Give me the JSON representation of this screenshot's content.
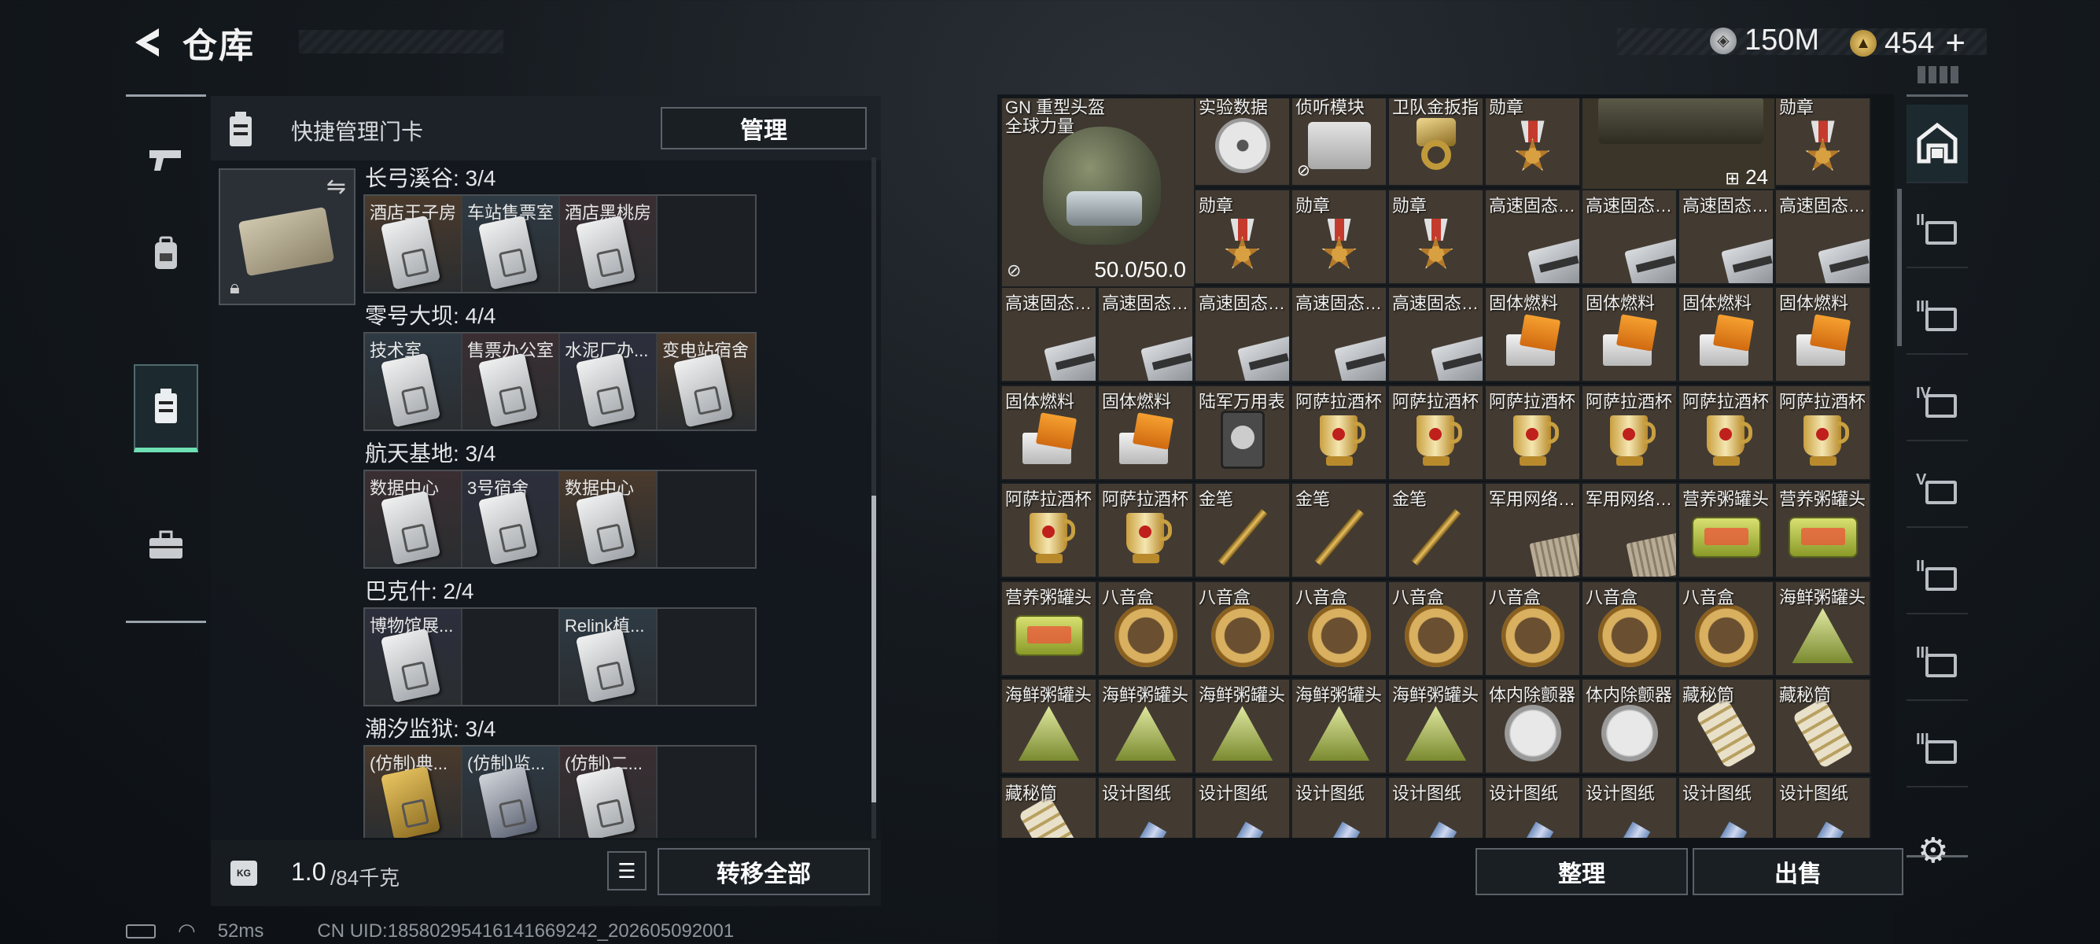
{
  "header": {
    "title": "仓库",
    "currency_a": "150M",
    "currency_b": "454"
  },
  "left_panel": {
    "head_label": "快捷管理门卡",
    "manage_label": "管理",
    "sections": [
      {
        "title": "长弓溪谷: 3/4",
        "cards": [
          {
            "label": "酒店王子房",
            "style": "normal"
          },
          {
            "label": "车站售票室",
            "style": "normal"
          },
          {
            "label": "酒店黑桃房",
            "style": "normal"
          },
          {
            "label": "",
            "style": "empty"
          }
        ]
      },
      {
        "title": "零号大坝: 4/4",
        "cards": [
          {
            "label": "技术室",
            "style": "normal"
          },
          {
            "label": "售票办公室",
            "style": "normal"
          },
          {
            "label": "水泥厂办...",
            "style": "normal"
          },
          {
            "label": "变电站宿舍",
            "style": "normal"
          }
        ]
      },
      {
        "title": "航天基地: 3/4",
        "cards": [
          {
            "label": "数据中心",
            "style": "normal"
          },
          {
            "label": "3号宿舍",
            "style": "normal"
          },
          {
            "label": "数据中心",
            "style": "normal"
          },
          {
            "label": "",
            "style": "empty"
          }
        ]
      },
      {
        "title": "巴克什: 2/4",
        "cards": [
          {
            "label": "博物馆展...",
            "style": "normal"
          },
          {
            "label": "",
            "style": "empty"
          },
          {
            "label": "Relink植...",
            "style": "normal"
          },
          {
            "label": "",
            "style": "empty"
          }
        ]
      },
      {
        "title": "潮汐监狱: 3/4",
        "cards": [
          {
            "label": "(仿制)典...",
            "style": "gold"
          },
          {
            "label": "(仿制)监...",
            "style": "dark"
          },
          {
            "label": "(仿制)二...",
            "style": "normal"
          },
          {
            "label": "",
            "style": "empty"
          }
        ]
      }
    ],
    "weight_value": "1.0",
    "weight_total": "/84千克",
    "weight_icon_text": "KG",
    "transfer_all_label": "转移全部"
  },
  "grid": {
    "helmet": {
      "name": "GN 重型头盔",
      "sub": "全球力量",
      "durability": "50.0/50.0"
    },
    "items": [
      {
        "col": 2,
        "row": 0,
        "name": "实验数据",
        "icon": "disc"
      },
      {
        "col": 3,
        "row": 0,
        "name": "侦听模块",
        "icon": "disk",
        "noicon": true
      },
      {
        "col": 4,
        "row": 0,
        "name": "卫队金扳指",
        "icon": "ring"
      },
      {
        "col": 5,
        "row": 0,
        "name": "勋章",
        "icon": "medal"
      },
      {
        "col": 8,
        "row": 0,
        "name": "勋章",
        "icon": "medal"
      },
      {
        "col": 2,
        "row": 1,
        "name": "勋章",
        "icon": "medal"
      },
      {
        "col": 3,
        "row": 1,
        "name": "勋章",
        "icon": "medal"
      },
      {
        "col": 4,
        "row": 1,
        "name": "勋章",
        "icon": "medal"
      },
      {
        "col": 5,
        "row": 1,
        "name": "高速固态硬盘",
        "icon": "drive"
      },
      {
        "col": 6,
        "row": 1,
        "name": "高速固态硬盘",
        "icon": "drive"
      },
      {
        "col": 7,
        "row": 1,
        "name": "高速固态硬盘",
        "icon": "drive"
      },
      {
        "col": 8,
        "row": 1,
        "name": "高速固态硬盘",
        "icon": "drive"
      },
      {
        "col": 0,
        "row": 2,
        "name": "高速固态硬盘",
        "icon": "drive"
      },
      {
        "col": 1,
        "row": 2,
        "name": "高速固态硬盘",
        "icon": "drive"
      },
      {
        "col": 2,
        "row": 2,
        "name": "高速固态硬盘",
        "icon": "drive"
      },
      {
        "col": 3,
        "row": 2,
        "name": "高速固态硬盘",
        "icon": "drive"
      },
      {
        "col": 4,
        "row": 2,
        "name": "高速固态硬盘",
        "icon": "drive"
      },
      {
        "col": 5,
        "row": 2,
        "name": "固体燃料",
        "icon": "fuel"
      },
      {
        "col": 6,
        "row": 2,
        "name": "固体燃料",
        "icon": "fuel"
      },
      {
        "col": 7,
        "row": 2,
        "name": "固体燃料",
        "icon": "fuel"
      },
      {
        "col": 8,
        "row": 2,
        "name": "固体燃料",
        "icon": "fuel"
      },
      {
        "col": 0,
        "row": 3,
        "name": "固体燃料",
        "icon": "fuel"
      },
      {
        "col": 1,
        "row": 3,
        "name": "固体燃料",
        "icon": "fuel"
      },
      {
        "col": 2,
        "row": 3,
        "name": "陆军万用表",
        "icon": "meter"
      },
      {
        "col": 3,
        "row": 3,
        "name": "阿萨拉酒杯",
        "icon": "cup"
      },
      {
        "col": 4,
        "row": 3,
        "name": "阿萨拉酒杯",
        "icon": "cup"
      },
      {
        "col": 5,
        "row": 3,
        "name": "阿萨拉酒杯",
        "icon": "cup"
      },
      {
        "col": 6,
        "row": 3,
        "name": "阿萨拉酒杯",
        "icon": "cup"
      },
      {
        "col": 7,
        "row": 3,
        "name": "阿萨拉酒杯",
        "icon": "cup"
      },
      {
        "col": 8,
        "row": 3,
        "name": "阿萨拉酒杯",
        "icon": "cup"
      },
      {
        "col": 0,
        "row": 4,
        "name": "阿萨拉酒杯",
        "icon": "cup"
      },
      {
        "col": 1,
        "row": 4,
        "name": "阿萨拉酒杯",
        "icon": "cup"
      },
      {
        "col": 2,
        "row": 4,
        "name": "金笔",
        "icon": "pen"
      },
      {
        "col": 3,
        "row": 4,
        "name": "金笔",
        "icon": "pen"
      },
      {
        "col": 4,
        "row": 4,
        "name": "金笔",
        "icon": "pen"
      },
      {
        "col": 5,
        "row": 4,
        "name": "军用网络模块",
        "icon": "net"
      },
      {
        "col": 6,
        "row": 4,
        "name": "军用网络模块",
        "icon": "net"
      },
      {
        "col": 7,
        "row": 4,
        "name": "营养粥罐头",
        "icon": "tin"
      },
      {
        "col": 8,
        "row": 4,
        "name": "营养粥罐头",
        "icon": "tin"
      },
      {
        "col": 0,
        "row": 5,
        "name": "营养粥罐头",
        "icon": "tin"
      },
      {
        "col": 1,
        "row": 5,
        "name": "八音盒",
        "icon": "music"
      },
      {
        "col": 2,
        "row": 5,
        "name": "八音盒",
        "icon": "music"
      },
      {
        "col": 3,
        "row": 5,
        "name": "八音盒",
        "icon": "music"
      },
      {
        "col": 4,
        "row": 5,
        "name": "八音盒",
        "icon": "music"
      },
      {
        "col": 5,
        "row": 5,
        "name": "八音盒",
        "icon": "music"
      },
      {
        "col": 6,
        "row": 5,
        "name": "八音盒",
        "icon": "music"
      },
      {
        "col": 7,
        "row": 5,
        "name": "八音盒",
        "icon": "music"
      },
      {
        "col": 8,
        "row": 5,
        "name": "海鲜粥罐头",
        "icon": "tri"
      },
      {
        "col": 0,
        "row": 6,
        "name": "海鲜粥罐头",
        "icon": "tri"
      },
      {
        "col": 1,
        "row": 6,
        "name": "海鲜粥罐头",
        "icon": "tri"
      },
      {
        "col": 2,
        "row": 6,
        "name": "海鲜粥罐头",
        "icon": "tri"
      },
      {
        "col": 3,
        "row": 6,
        "name": "海鲜粥罐头",
        "icon": "tri"
      },
      {
        "col": 4,
        "row": 6,
        "name": "海鲜粥罐头",
        "icon": "tri"
      },
      {
        "col": 5,
        "row": 6,
        "name": "体内除颤器",
        "icon": "implant"
      },
      {
        "col": 6,
        "row": 6,
        "name": "体内除颤器",
        "icon": "implant"
      },
      {
        "col": 7,
        "row": 6,
        "name": "藏秘筒",
        "icon": "roll"
      },
      {
        "col": 8,
        "row": 6,
        "name": "藏秘筒",
        "icon": "roll"
      },
      {
        "col": 0,
        "row": 7,
        "name": "藏秘筒",
        "icon": "roll"
      },
      {
        "col": 1,
        "row": 7,
        "name": "设计图纸",
        "icon": "bp"
      },
      {
        "col": 2,
        "row": 7,
        "name": "设计图纸",
        "icon": "bp"
      },
      {
        "col": 3,
        "row": 7,
        "name": "设计图纸",
        "icon": "bp"
      },
      {
        "col": 4,
        "row": 7,
        "name": "设计图纸",
        "icon": "bp"
      },
      {
        "col": 5,
        "row": 7,
        "name": "设计图纸",
        "icon": "bp"
      },
      {
        "col": 6,
        "row": 7,
        "name": "设计图纸",
        "icon": "bp"
      },
      {
        "col": 7,
        "row": 7,
        "name": "设计图纸",
        "icon": "bp"
      },
      {
        "col": 8,
        "row": 7,
        "name": "设计图纸",
        "icon": "bp"
      }
    ],
    "stack_count": "24",
    "sort_label": "整理",
    "sell_label": "出售"
  },
  "right_tabs": [
    "II",
    "III",
    "IV",
    "V",
    "II",
    "III",
    "III"
  ],
  "status": {
    "ping": "52ms",
    "uid": "CN UID:18580295416141669242_202605092001"
  }
}
